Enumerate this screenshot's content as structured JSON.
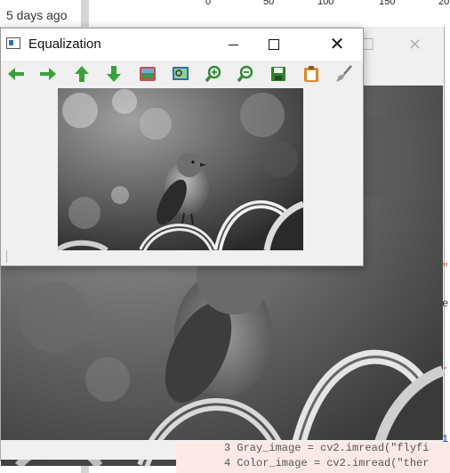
{
  "background": {
    "file_age": "5 days ago",
    "axis_ticks": [
      "0",
      "50",
      "100",
      "150",
      "20"
    ],
    "code_lines": [
      "3 Gray_image = cv2.imread(\"flyfi",
      "4 Color_image = cv2.imread(\"ther"
    ]
  },
  "window": {
    "title": "Equalization",
    "controls": {
      "minimize": "minimize",
      "maximize": "maximize",
      "close": "close"
    }
  },
  "toolbar": [
    {
      "icon": "arrow-left-icon",
      "color": "#3aa13a"
    },
    {
      "icon": "arrow-right-icon",
      "color": "#3aa13a"
    },
    {
      "icon": "arrow-up-icon",
      "color": "#3aa13a"
    },
    {
      "icon": "arrow-down-icon",
      "color": "#3aa13a"
    },
    {
      "icon": "image-icon",
      "color": "#c0504d"
    },
    {
      "icon": "image-zoom-icon",
      "color": "#2f6fb5"
    },
    {
      "icon": "zoom-in-icon",
      "color": "#3a8a3a"
    },
    {
      "icon": "zoom-out-icon",
      "color": "#3a8a3a"
    },
    {
      "icon": "save-icon",
      "color": "#2f7f2f"
    },
    {
      "icon": "clipboard-icon",
      "color": "#d98a2b"
    },
    {
      "icon": "brush-icon",
      "color": "#888888"
    }
  ]
}
